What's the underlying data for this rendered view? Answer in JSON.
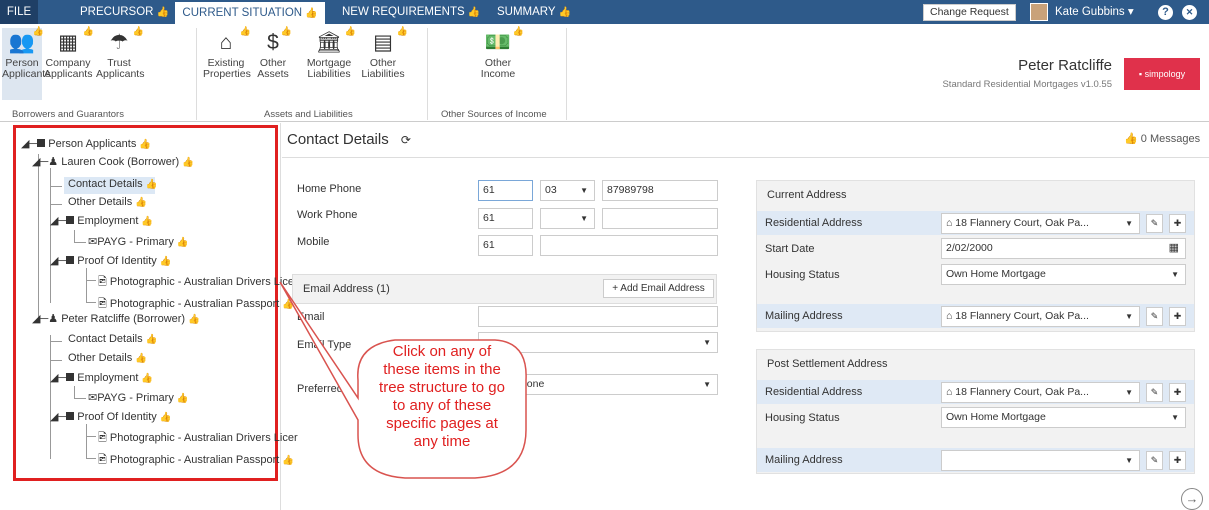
{
  "nav": {
    "file": "FILE",
    "precursor": "PRECURSOR",
    "current": "CURRENT SITUATION",
    "new_req": "NEW REQUIREMENTS",
    "summary": "SUMMARY",
    "change_request": "Change Request",
    "user": "Kate Gubbins ▾",
    "help": "?",
    "close": "✕"
  },
  "ribbon": {
    "person": "Person Applicants",
    "company": "Company Applicants",
    "trust": "Trust Applicants",
    "grp1": "Borrowers and Guarantors",
    "existing": "Existing Properties",
    "other_assets": "Other Assets",
    "mortgage": "Mortgage Liabilities",
    "other_liab": "Other Liabilities",
    "grp2": "Assets and Liabilities",
    "other_income": "Other Income",
    "grp3": "Other Sources of Income"
  },
  "profile": {
    "name": "Peter Ratcliffe",
    "subtitle": "Standard Residential Mortgages v1.0.55",
    "logo": "simpology"
  },
  "tree": {
    "root": "Person Applicants",
    "b1": "Lauren Cook (Borrower)",
    "b1_contact": "Contact Details",
    "b1_other": "Other Details",
    "b1_emp": "Employment",
    "b1_payg": "PAYG - Primary",
    "b1_poi": "Proof Of Identity",
    "b1_doc1": "Photographic - Australian Drivers Licer",
    "b1_doc2": "Photographic - Australian Passport",
    "b2": "Peter Ratcliffe (Borrower)",
    "b2_contact": "Contact Details",
    "b2_other": "Other Details",
    "b2_emp": "Employment",
    "b2_payg": "PAYG - Primary",
    "b2_poi": "Proof Of Identity",
    "b2_doc1": "Photographic - Australian Drivers Licer",
    "b2_doc2": "Photographic - Australian Passport"
  },
  "content": {
    "title": "Contact Details",
    "messages": "0 Messages",
    "home_phone": "Home Phone",
    "work_phone": "Work Phone",
    "mobile": "Mobile",
    "home_cc": "61",
    "home_area": "03",
    "home_num": "87989798",
    "work_cc": "61",
    "mobile_cc": "61",
    "email_header": "Email Address (1)",
    "add_email": "+ Add Email Address",
    "email": "Email",
    "email_type": "Email Type",
    "preferred": "Preferred",
    "preferred_value": "Home Phone"
  },
  "current": {
    "title": "Current Address",
    "res_label": "Residential Address",
    "res_value": "18 Flannery Court, Oak Pa...",
    "start_label": "Start Date",
    "start_value": "2/02/2000",
    "housing_label": "Housing Status",
    "housing_value": "Own Home Mortgage",
    "mailing_label": "Mailing Address",
    "mailing_value": "18 Flannery Court, Oak Pa..."
  },
  "post": {
    "title": "Post Settlement Address",
    "res_label": "Residential Address",
    "res_value": "18 Flannery Court, Oak Pa...",
    "housing_label": "Housing Status",
    "housing_value": "Own Home Mortgage",
    "mailing_label": "Mailing Address"
  },
  "callout": {
    "l1": "Click on any of",
    "l2": "these items in the",
    "l3": "tree structure to go",
    "l4": "to any of these",
    "l5": "specific pages at",
    "l6": "any time"
  },
  "colors": {
    "nav": "#2e5a8a",
    "accent_red": "#e02020",
    "thumb_green": "#5a8f29"
  }
}
